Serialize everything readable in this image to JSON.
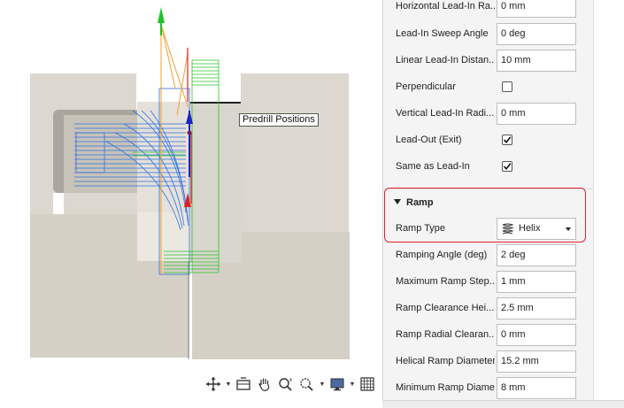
{
  "viewport": {
    "tooltip": "Predrill Positions"
  },
  "toolbar": {
    "items": [
      {
        "icon": "orbit-icon",
        "has_dropdown": true
      },
      {
        "icon": "look-at-icon",
        "has_dropdown": false
      },
      {
        "icon": "pan-hand-icon",
        "has_dropdown": false
      },
      {
        "icon": "zoom-icon",
        "has_dropdown": false
      },
      {
        "icon": "zoom-window-icon",
        "has_dropdown": true
      },
      {
        "icon": "display-settings-icon",
        "has_dropdown": true
      },
      {
        "icon": "grid-icon",
        "has_dropdown": true
      }
    ]
  },
  "panel": {
    "rows_top": [
      {
        "label": "Horizontal Lead-In Ra...",
        "value": "0 mm"
      },
      {
        "label": "Lead-In Sweep Angle",
        "value": "0 deg"
      },
      {
        "label": "Linear Lead-In Distan...",
        "value": "10 mm"
      }
    ],
    "perpendicular": {
      "label": "Perpendicular",
      "checked": false
    },
    "vertical_leadin": {
      "label": "Vertical Lead-In Radi...",
      "value": "0 mm"
    },
    "leadout": {
      "label": "Lead-Out (Exit)",
      "checked": true
    },
    "same_as_leadin": {
      "label": "Same as Lead-In",
      "checked": true
    },
    "ramp": {
      "title": "Ramp",
      "ramp_type_label": "Ramp Type",
      "ramp_type_value": "Helix",
      "rows": [
        {
          "label": "Ramping Angle (deg)",
          "value": "2 deg"
        },
        {
          "label": "Maximum Ramp Step...",
          "value": "1 mm"
        },
        {
          "label": "Ramp Clearance Hei...",
          "value": "2.5 mm"
        },
        {
          "label": "Ramp Radial Clearan...",
          "value": "0 mm"
        },
        {
          "label": "Helical Ramp Diameter",
          "value": "15.2 mm"
        },
        {
          "label": "Minimum Ramp Diame...",
          "value": "8 mm"
        }
      ]
    }
  },
  "colors": {
    "highlight": "#e0242b",
    "toolpath_blue": "#2f6fe0",
    "toolpath_green": "#2ec22e",
    "toolpath_red": "#e02020",
    "toolpath_orange": "#f0a030",
    "stock": "#dcd8cf"
  }
}
